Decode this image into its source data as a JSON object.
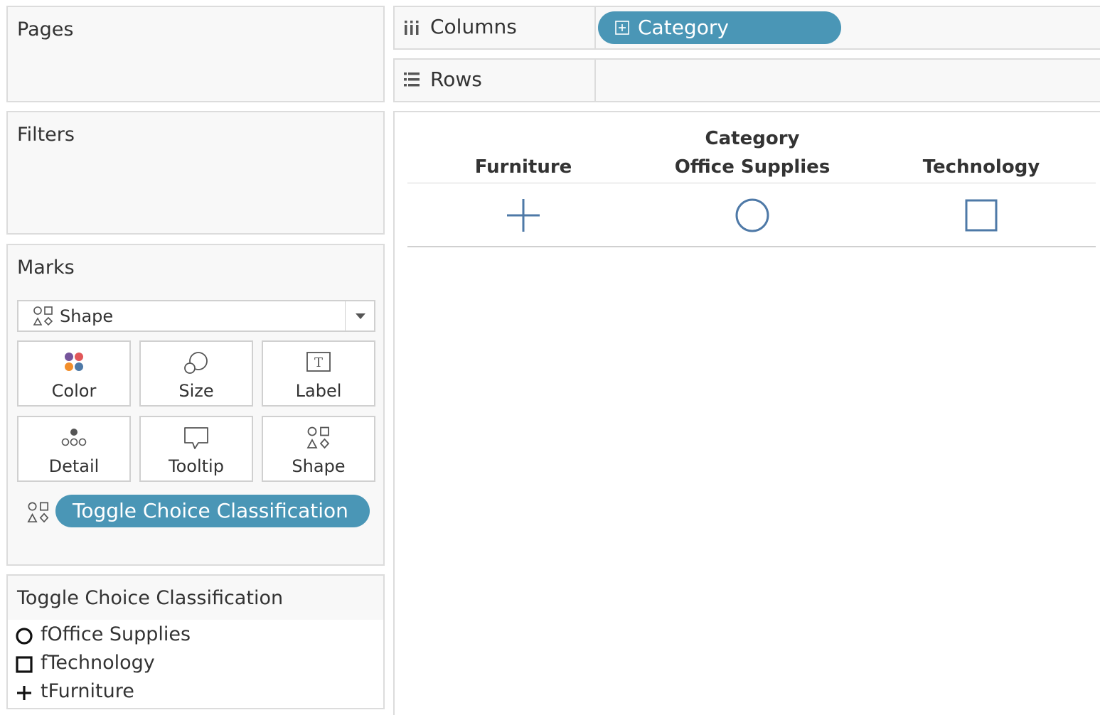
{
  "pages_card": {
    "title": "Pages"
  },
  "filters_card": {
    "title": "Filters"
  },
  "marks_card": {
    "title": "Marks",
    "mark_type": "Shape",
    "buttons": [
      {
        "label": "Color",
        "icon": "color-icon"
      },
      {
        "label": "Size",
        "icon": "size-icon"
      },
      {
        "label": "Label",
        "icon": "label-icon"
      },
      {
        "label": "Detail",
        "icon": "detail-icon"
      },
      {
        "label": "Tooltip",
        "icon": "tooltip-icon"
      },
      {
        "label": "Shape",
        "icon": "shape-icon"
      }
    ],
    "shape_pill": "Toggle Choice Classification"
  },
  "shelves": {
    "columns_label": "Columns",
    "columns_pill": "Category",
    "rows_label": "Rows"
  },
  "viz": {
    "group_header": "Category",
    "columns": [
      "Furniture",
      "Office Supplies",
      "Technology"
    ],
    "shapes": [
      "plus",
      "circle",
      "square"
    ],
    "mark_color": "#4e79a7"
  },
  "legend": {
    "title": "Toggle Choice Classification",
    "items": [
      {
        "label": "fOffice Supplies",
        "shape": "circle"
      },
      {
        "label": "fTechnology",
        "shape": "square"
      },
      {
        "label": "tFurniture",
        "shape": "plus"
      }
    ]
  },
  "colors": {
    "pill": "#4a96b6",
    "card_bg": "#f8f8f8",
    "border": "#dcdcdc"
  }
}
